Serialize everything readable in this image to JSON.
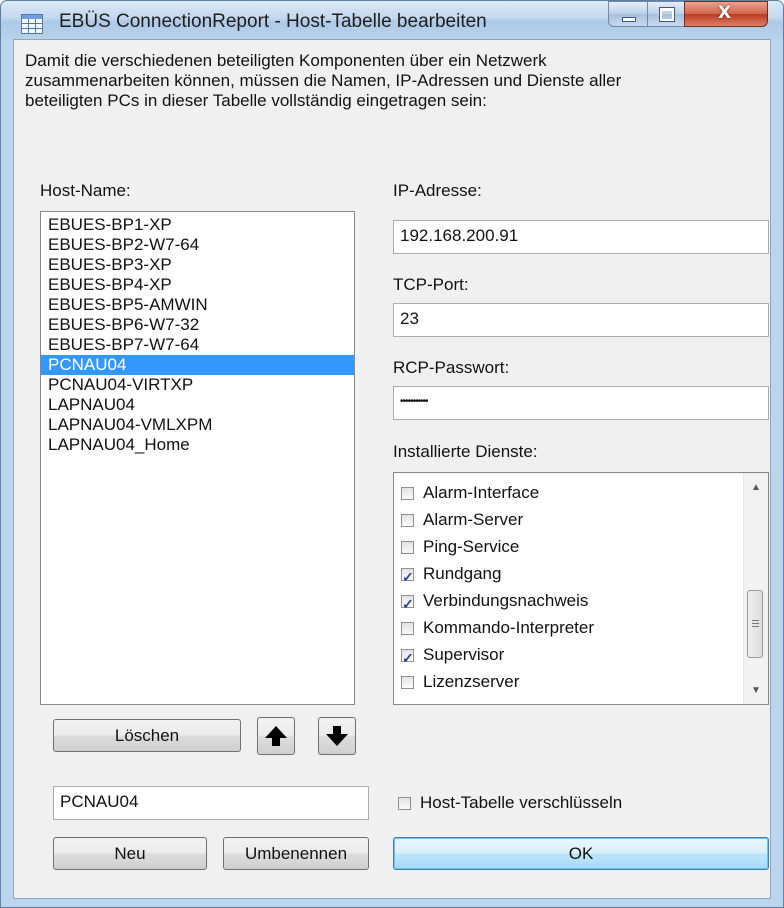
{
  "window": {
    "title": "EBÜS ConnectionReport - Host-Tabelle bearbeiten",
    "close_glyph": "X"
  },
  "description": {
    "line1": "Damit die verschiedenen beteiligten Komponenten über ein Netzwerk",
    "line2": "zusammenarbeiten können, müssen die Namen, IP-Adressen und Dienste aller",
    "line3": "beteiligten PCs in dieser Tabelle vollständig eingetragen sein:"
  },
  "host_list": {
    "label": "Host-Name:",
    "items": [
      "EBUES-BP1-XP",
      "EBUES-BP2-W7-64",
      "EBUES-BP3-XP",
      "EBUES-BP4-XP",
      "EBUES-BP5-AMWIN",
      "EBUES-BP6-W7-32",
      "EBUES-BP7-W7-64",
      "PCNAU04",
      "PCNAU04-VIRTXP",
      "LAPNAU04",
      "LAPNAU04-VMLXPM",
      "LAPNAU04_Home"
    ],
    "selected_index": 7
  },
  "ip": {
    "label": "IP-Adresse:",
    "value": "192.168.200.91"
  },
  "port": {
    "label": "TCP-Port:",
    "value": "23"
  },
  "password": {
    "label": "RCP-Passwort:",
    "value": "•••••••••••"
  },
  "services": {
    "label": "Installierte Dienste:",
    "items": [
      {
        "label": "Alarm-Interface",
        "checked": false
      },
      {
        "label": "Alarm-Server",
        "checked": false
      },
      {
        "label": "Ping-Service",
        "checked": false
      },
      {
        "label": "Rundgang",
        "checked": true
      },
      {
        "label": "Verbindungsnachweis",
        "checked": true
      },
      {
        "label": "Kommando-Interpreter",
        "checked": false
      },
      {
        "label": "Supervisor",
        "checked": true
      },
      {
        "label": "Lizenzserver",
        "checked": false
      }
    ]
  },
  "buttons": {
    "delete": "Löschen",
    "new": "Neu",
    "rename": "Umbenennen",
    "ok": "OK"
  },
  "name_input": {
    "value": "PCNAU04"
  },
  "encrypt": {
    "label": "Host-Tabelle verschlüsseln",
    "checked": false
  },
  "colors": {
    "selection": "#3399ff",
    "check": "#2b3f8c"
  }
}
